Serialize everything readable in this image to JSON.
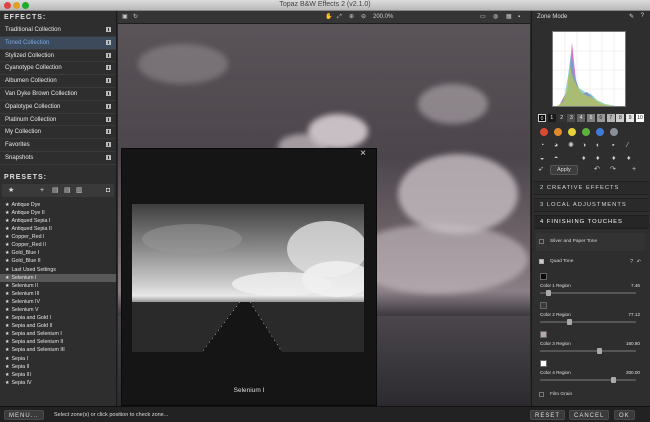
{
  "window": {
    "title": "Topaz B&W Effects 2 (v2.1.0)"
  },
  "effects_panel": {
    "heading": "EFFECTS:",
    "collections": [
      {
        "label": "Traditional Collection",
        "selected": false
      },
      {
        "label": "Toned Collection",
        "selected": true
      },
      {
        "label": "Stylized Collection",
        "selected": false
      },
      {
        "label": "Cyanotype Collection",
        "selected": false
      },
      {
        "label": "Albumen Collection",
        "selected": false
      },
      {
        "label": "Van Dyke Brown Collection",
        "selected": false
      },
      {
        "label": "Opalotype Collection",
        "selected": false
      },
      {
        "label": "Platinum Collection",
        "selected": false
      },
      {
        "label": "My Collection",
        "selected": false
      },
      {
        "label": "Favorites",
        "selected": false
      },
      {
        "label": "Snapshots",
        "selected": false
      }
    ]
  },
  "presets_panel": {
    "heading": "PRESETS:",
    "toolbar_icons": [
      "star-icon",
      "add-icon",
      "document-icon",
      "document-icon",
      "trash-icon",
      "camera-icon"
    ],
    "items": [
      {
        "label": "Antique Dye",
        "selected": false
      },
      {
        "label": "Antique Dye II",
        "selected": false
      },
      {
        "label": "Antiqued Sepia I",
        "selected": false
      },
      {
        "label": "Antiqued Sepia II",
        "selected": false
      },
      {
        "label": "Copper_Red I",
        "selected": false
      },
      {
        "label": "Copper_Red II",
        "selected": false
      },
      {
        "label": "Gold_Blue I",
        "selected": false
      },
      {
        "label": "Gold_Blue II",
        "selected": false
      },
      {
        "label": "Last Used Settings",
        "selected": false
      },
      {
        "label": "Selenium I",
        "selected": true
      },
      {
        "label": "Selenium II",
        "selected": false
      },
      {
        "label": "Selenium III",
        "selected": false
      },
      {
        "label": "Selenium IV",
        "selected": false
      },
      {
        "label": "Selenium V",
        "selected": false
      },
      {
        "label": "Sepia and Gold I",
        "selected": false
      },
      {
        "label": "Sepia and Gold II",
        "selected": false
      },
      {
        "label": "Sepia and Selenium I",
        "selected": false
      },
      {
        "label": "Sepia and Selenium II",
        "selected": false
      },
      {
        "label": "Sepia and Selenium III",
        "selected": false
      },
      {
        "label": "Sepia I",
        "selected": false
      },
      {
        "label": "Sepia II",
        "selected": false
      },
      {
        "label": "Sepia III",
        "selected": false
      },
      {
        "label": "Sepia IV",
        "selected": false
      }
    ]
  },
  "viewer": {
    "zoom": "200.0%"
  },
  "preview_popup": {
    "caption": "Selenium I",
    "close_icon": "close-icon"
  },
  "zone_panel": {
    "heading": "Zone Mode",
    "zones": [
      "0",
      "1",
      "2",
      "3",
      "4",
      "5",
      "6",
      "7",
      "8",
      "9",
      "10"
    ],
    "colors": [
      "#d84a32",
      "#e08a2a",
      "#e8d23a",
      "#5bb33e",
      "#3f7ad6",
      "#8a8f96"
    ],
    "apply_label": "Apply"
  },
  "sections": {
    "creative_effects": "2 CREATIVE EFFECTS",
    "local_adjustments": "3 LOCAL ADJUSTMENTS",
    "finishing_touches": "4 FINISHING TOUCHES",
    "silver_paper_tone": "Silver and Paper Tone",
    "quad_tone": "Quad Tone",
    "film_grain": "Film Grain"
  },
  "quad_tone": {
    "regions": [
      {
        "label": "Color 1 Region",
        "value": "7.46",
        "swatch": "#0a0a0a",
        "fraction": 0.07
      },
      {
        "label": "Color 2 Region",
        "value": "77.12",
        "swatch": "#3a3a3a",
        "fraction": 0.3
      },
      {
        "label": "Color 3 Region",
        "value": "160.80",
        "swatch": "#b9a8b3",
        "fraction": 0.63
      },
      {
        "label": "Color 4 Region",
        "value": "200.00",
        "swatch": "#ffffff",
        "fraction": 0.78
      }
    ]
  },
  "bottom_bar": {
    "menu_label": "MENU...",
    "status": "Select zone(s) or click position to check zone...",
    "reset_label": "RESET",
    "cancel_label": "CANCEL",
    "ok_label": "OK"
  }
}
